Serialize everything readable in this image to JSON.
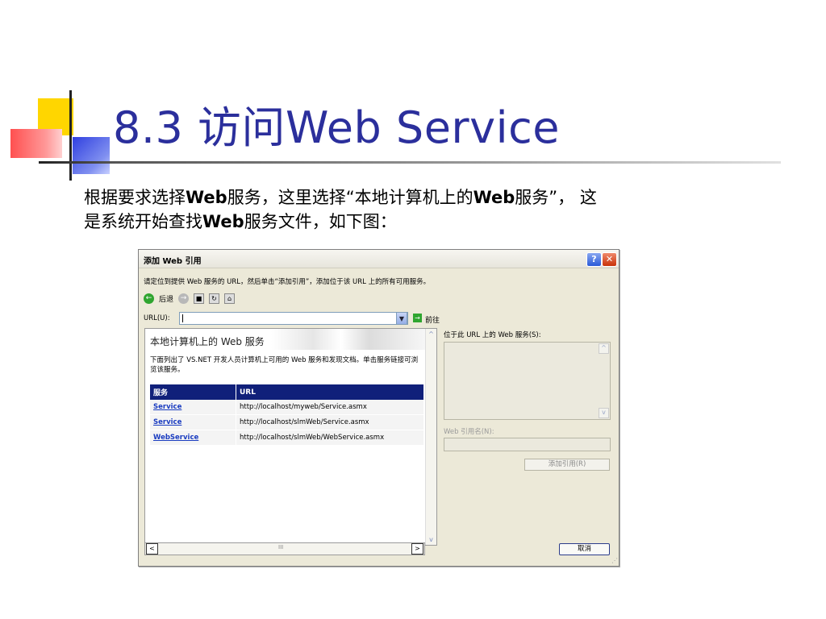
{
  "slide": {
    "title": "8.3   访问Web Service",
    "body_line1": [
      {
        "t": "根据要求选择",
        "b": false
      },
      {
        "t": "Web",
        "b": true
      },
      {
        "t": "服务，这里选择“本地计算机上的",
        "b": false
      },
      {
        "t": "Web",
        "b": true
      },
      {
        "t": "服务”， 这",
        "b": false
      }
    ],
    "body_line2": [
      {
        "t": "是系统开始查找",
        "b": false
      },
      {
        "t": "Web",
        "b": true
      },
      {
        "t": "服务文件，如下图：",
        "b": false
      }
    ]
  },
  "dialog": {
    "title": "添加 Web 引用",
    "help_glyph": "?",
    "close_glyph": "✕",
    "instruction": "请定位到提供 Web 服务的 URL，然后单击“添加引用”，添加位于该 URL 上的所有可用服务。",
    "toolbar": {
      "back_label": "后退",
      "back_glyph": "←",
      "forward_glyph": "→",
      "stop_glyph": "■",
      "refresh_glyph": "↻",
      "home_glyph": "⌂"
    },
    "url_label": "URL(U):",
    "url_value": "",
    "dropdown_glyph": "▼",
    "go_glyph": "→",
    "go_label": "前往",
    "page": {
      "heading": "本地计算机上的 Web 服务",
      "description": "下面列出了 VS.NET 开发人员计算机上可用的 Web 服务和发现文档。单击服务链接可浏览该服务。",
      "columns": [
        "服务",
        "URL"
      ],
      "rows": [
        {
          "name": "Service",
          "url": "http://localhost/myweb/Service.asmx"
        },
        {
          "name": "Service",
          "url": "http://localhost/slmWeb/Service.asmx"
        },
        {
          "name": "WebService",
          "url": "http://localhost/slmWeb/WebService.asmx"
        }
      ]
    },
    "scroll_up": "^",
    "scroll_down": "v",
    "scroll_left": "<",
    "scroll_right": ">",
    "scroll_thumb": "III",
    "right_label": "位于此 URL 上的 Web 服务(S):",
    "ref_name_label": "Web 引用名(N):",
    "add_button": "添加引用(R)",
    "cancel_button": "取消"
  }
}
